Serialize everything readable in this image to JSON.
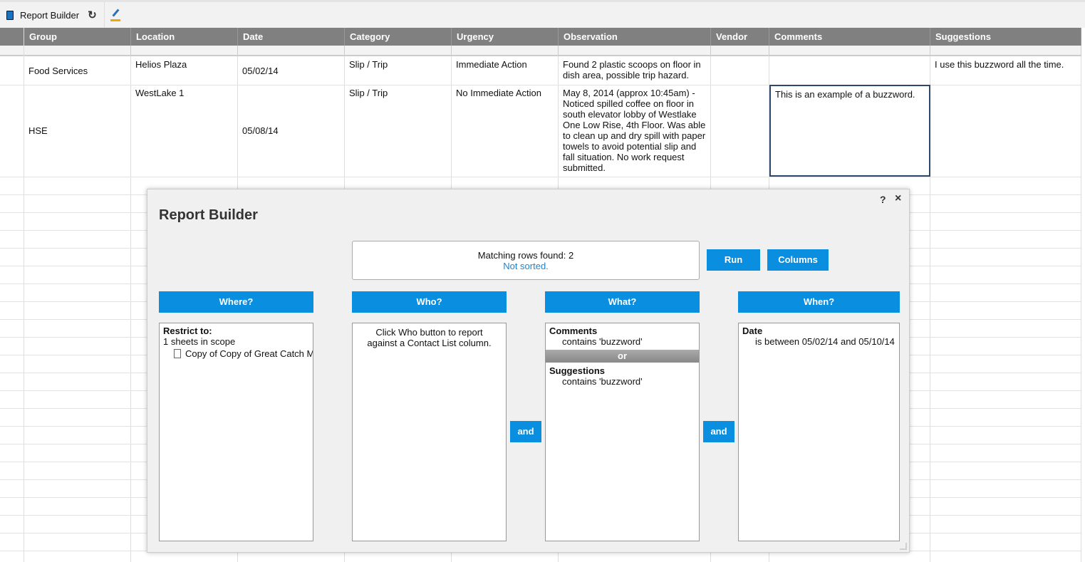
{
  "toolbar": {
    "title": "Report Builder",
    "icons": [
      "report-book-icon",
      "refresh-icon",
      "highlight-pen-icon"
    ]
  },
  "sheet": {
    "columns": [
      "Group",
      "Location",
      "Date",
      "Category",
      "Urgency",
      "Observation",
      "Vendor",
      "Comments",
      "Suggestions"
    ],
    "rows": [
      {
        "group": "Food Services",
        "location": "Helios Plaza",
        "date": "05/02/14",
        "category": "Slip / Trip",
        "urgency": "Immediate Action",
        "observation": "Found 2 plastic scoops on floor in dish area, possible trip hazard.",
        "vendor": "",
        "comments": "",
        "suggestions": "I use this buzzword all the time."
      },
      {
        "group": "HSE",
        "location": "WestLake 1",
        "date": "05/08/14",
        "category": "Slip / Trip",
        "urgency": "No Immediate Action",
        "observation": "May 8, 2014 (approx 10:45am) - Noticed spilled coffee on floor in south elevator lobby of Westlake One Low Rise, 4th Floor. Was able to clean up and dry spill with paper towels to avoid potential slip and fall situation. No work request submitted.",
        "vendor": "",
        "comments": "This is an example of a buzzword.",
        "suggestions": ""
      }
    ]
  },
  "dialog": {
    "title": "Report Builder",
    "help": "?",
    "close": "×",
    "status": {
      "matching": "Matching rows found: 2",
      "sort": "Not sorted."
    },
    "run": "Run",
    "columns": "Columns",
    "where": {
      "label": "Where?",
      "heading": "Restrict to:",
      "scope": "1 sheets in scope",
      "sheet": "Copy of Copy of Great Catch M"
    },
    "who": {
      "label": "Who?",
      "hint": "Click Who button to report against a Contact List column."
    },
    "what": {
      "label": "What?",
      "c1": "Comments",
      "c1v": "contains 'buzzword'",
      "or": "or",
      "c2": "Suggestions",
      "c2v": "contains 'buzzword'"
    },
    "when": {
      "label": "When?",
      "c1": "Date",
      "c1v": "is between 05/02/14 and 05/10/14"
    },
    "and": "and"
  }
}
